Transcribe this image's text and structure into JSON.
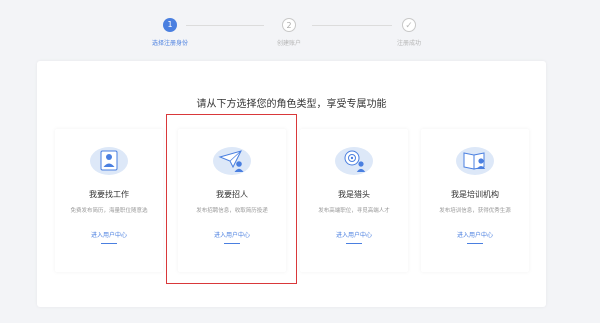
{
  "stepper": {
    "steps": [
      {
        "number": "1",
        "label": "选择注册身份",
        "state": "active"
      },
      {
        "number": "2",
        "label": "创建账户",
        "state": "todo"
      },
      {
        "number": "✓",
        "label": "注册成功",
        "state": "done"
      }
    ]
  },
  "panel": {
    "title": "请从下方选择您的角色类型，享受专属功能"
  },
  "roles": [
    {
      "name": "我要找工作",
      "desc": "免费发布简历，海量职位随意选",
      "enter": "进入用户中心",
      "icon": "user-resume-icon"
    },
    {
      "name": "我要招人",
      "desc": "发布招聘信息，收取简历投递",
      "enter": "进入用户中心",
      "icon": "paper-plane-user-icon"
    },
    {
      "name": "我是猎头",
      "desc": "发布高端职位，寻觅高端人才",
      "enter": "进入用户中心",
      "icon": "headhunter-target-icon"
    },
    {
      "name": "我是培训机构",
      "desc": "发布培训信息，获得优秀生源",
      "enter": "进入用户中心",
      "icon": "training-book-icon"
    }
  ],
  "colors": {
    "accent": "#4a7fe0",
    "highlight": "#d9383a",
    "icon_bg": "#dde8f8",
    "icon_fg": "#4a7fe0"
  }
}
